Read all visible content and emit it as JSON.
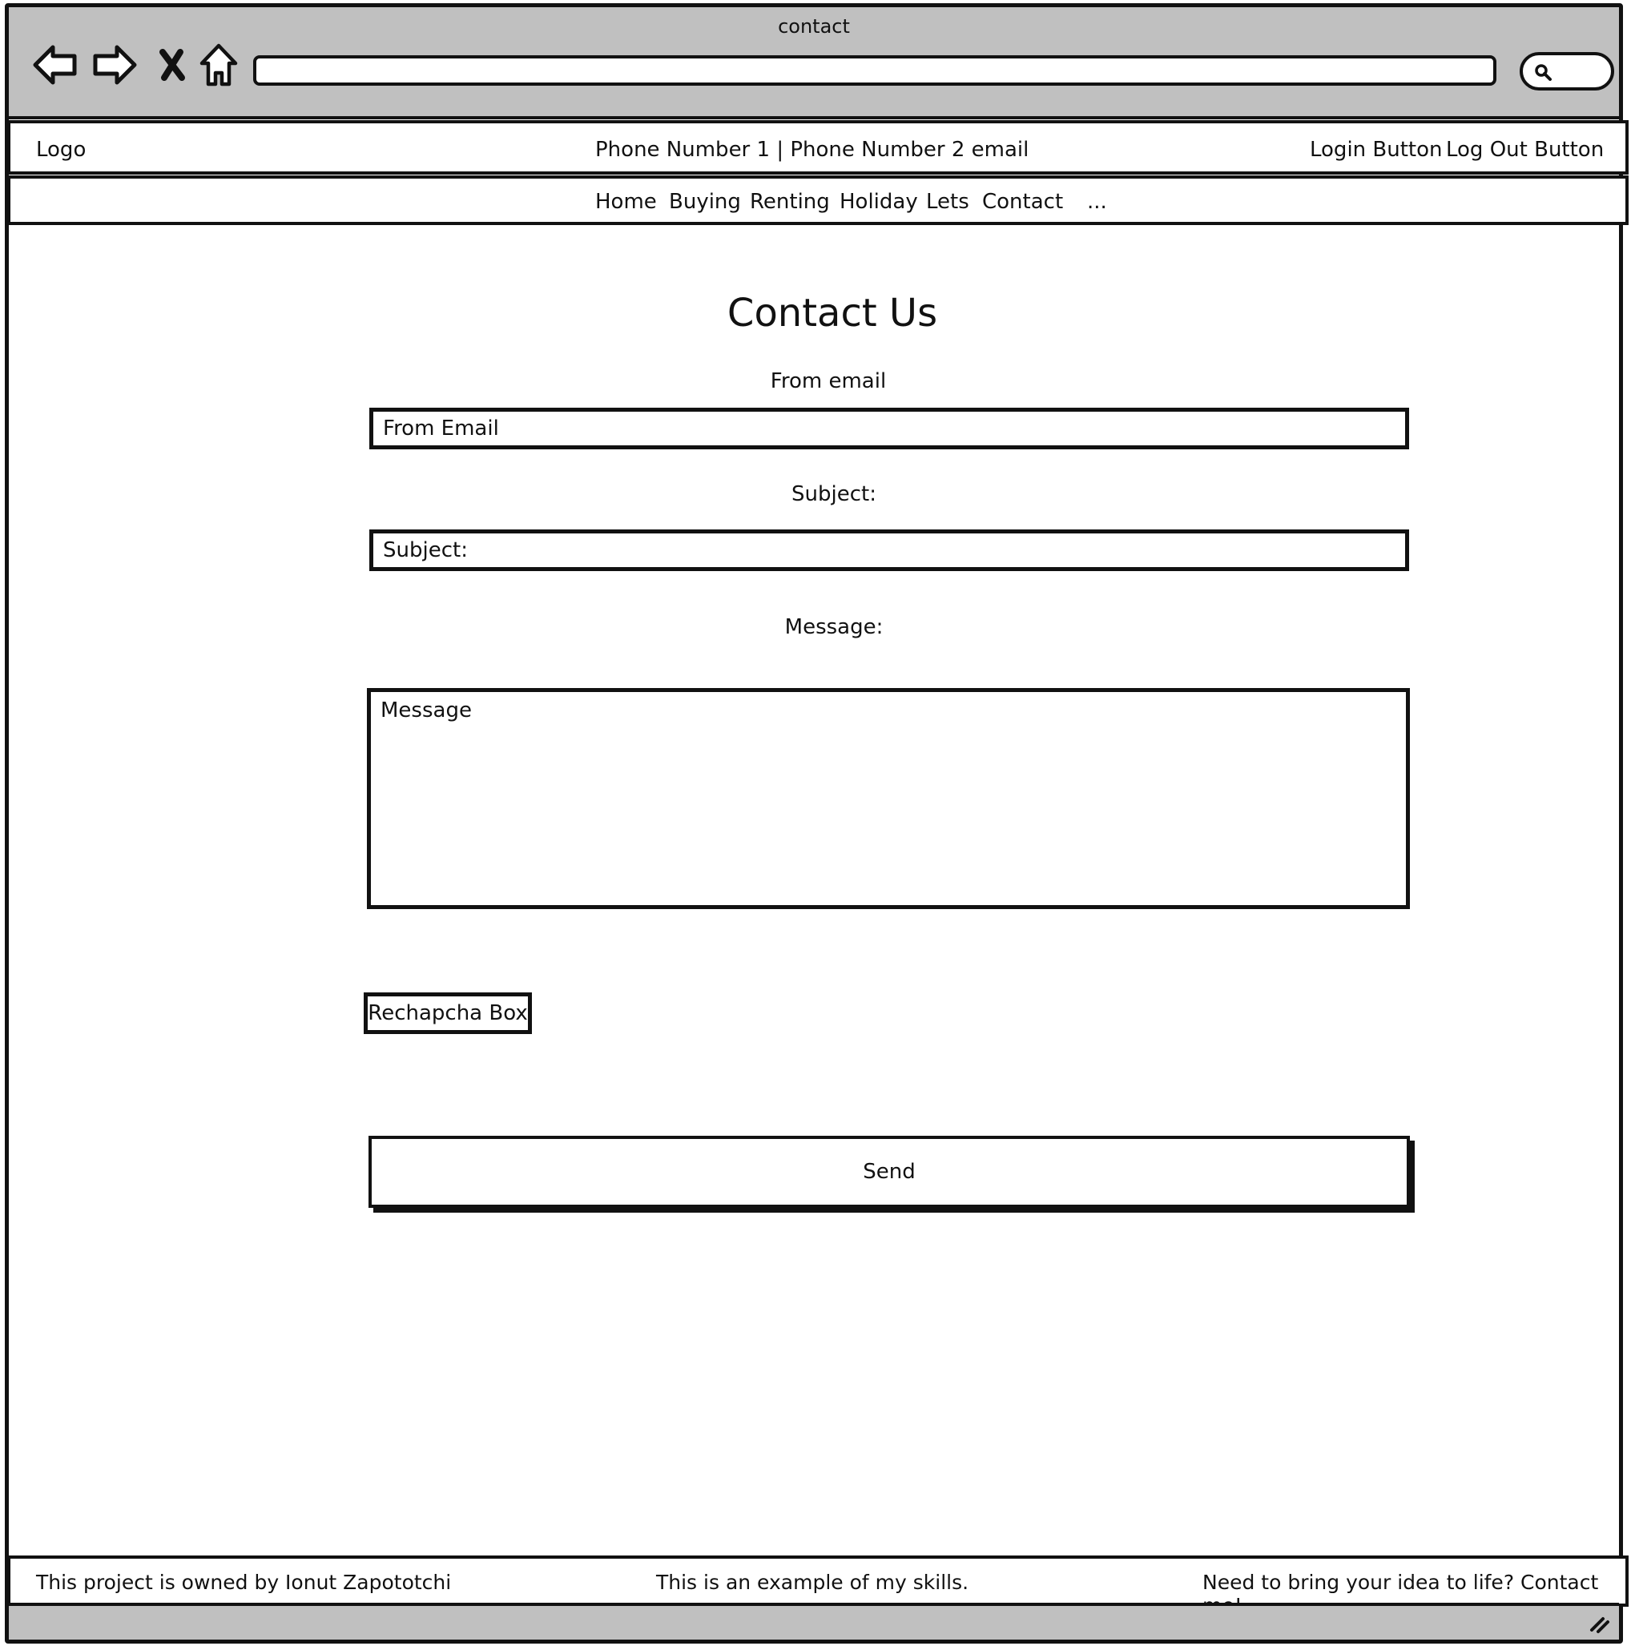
{
  "window": {
    "title": "contact"
  },
  "browser": {
    "icons": [
      "back-arrow-icon",
      "forward-arrow-icon",
      "close-x-icon",
      "home-icon",
      "search-icon"
    ],
    "address_value": ""
  },
  "header": {
    "logo": "Logo",
    "contact_info": "Phone Number 1 | Phone Number 2  email",
    "login_button": "Login Button",
    "logout_button": "Log Out Button"
  },
  "nav": {
    "items": [
      {
        "label": "Home"
      },
      {
        "label": "Buying"
      },
      {
        "label": "Renting"
      },
      {
        "label": "Holiday"
      },
      {
        "label": "Lets"
      },
      {
        "label": "Contact"
      },
      {
        "label": "..."
      }
    ]
  },
  "form": {
    "heading": "Contact Us",
    "from_email_label": "From email",
    "from_email_placeholder": "From Email",
    "subject_label": "Subject:",
    "subject_placeholder": "Subject:",
    "message_label": "Message:",
    "message_placeholder": "Message",
    "captcha_label": "Rechapcha Box",
    "send_button": "Send"
  },
  "footer": {
    "owner": "This project is owned by Ionut Zapototchi",
    "example": "This is an example of my skills.",
    "cta": "Need to bring your idea to life? Contact me!"
  }
}
